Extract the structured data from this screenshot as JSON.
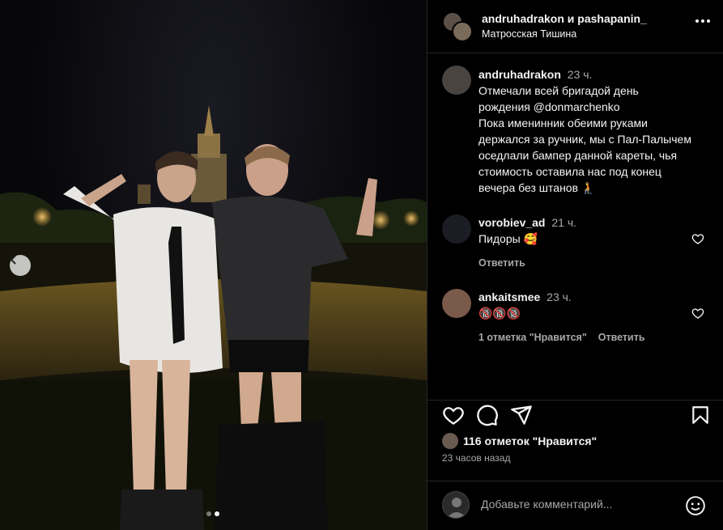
{
  "post": {
    "authors": {
      "primary": "andruhadrakon",
      "joiner": "и",
      "secondary": "pashapanin_"
    },
    "location": "Матросская Тишина"
  },
  "caption": {
    "username": "andruhadrakon",
    "time": "23 ч.",
    "lines": [
      "Отмечали всей бригадой день",
      "рождения @donmarchenko",
      "Пока именинник обеими руками",
      "держался за ручник, мы с Пал-Палычем",
      "оседлали бампер данной кареты, чья",
      "стоимость оставила нас под конец",
      "вечера без штанов 🧎"
    ]
  },
  "comments": [
    {
      "username": "vorobiev_ad",
      "time": "21 ч.",
      "text": "Пидоры 🥰",
      "reply": "Ответить",
      "likes": ""
    },
    {
      "username": "ankaitsmee",
      "time": "23 ч.",
      "text": "🔞🔞🔞",
      "likes": "1 отметка \"Нравится\"",
      "reply": "Ответить"
    }
  ],
  "engagement": {
    "likes_text": "116 отметок \"Нравится\"",
    "posted": "23 часов назад"
  },
  "composer": {
    "placeholder": "Добавьте комментарий..."
  },
  "carousel": {
    "total": 2,
    "active": 2
  },
  "colors": {
    "background": "#000000",
    "text": "#f5f5f5",
    "muted": "#a8a8a8",
    "divider": "#262626"
  }
}
